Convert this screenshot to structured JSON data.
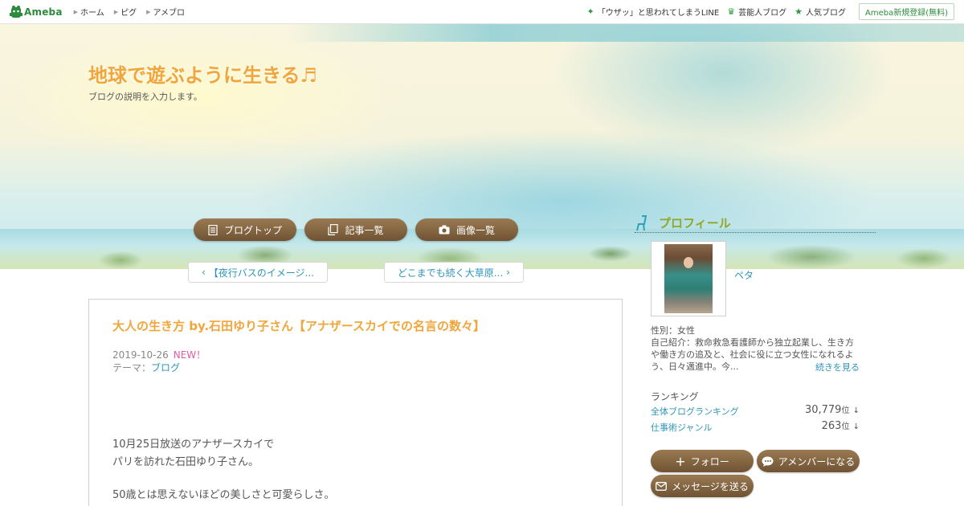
{
  "topbar": {
    "logo_text": "Ameba",
    "nav": [
      {
        "label": "ホーム"
      },
      {
        "label": "ピグ"
      },
      {
        "label": "アメブロ"
      }
    ],
    "right_links": [
      {
        "label": "「ウザッ」と思われてしまうLINE",
        "icon": "sparkle-icon"
      },
      {
        "label": "芸能人ブログ",
        "icon": "crown-icon"
      },
      {
        "label": "人気ブログ",
        "icon": "star-icon"
      }
    ],
    "signup_label": "Ameba新規登録(無料)"
  },
  "blog": {
    "title": "地球で遊ぶように生きる♬",
    "description": "ブログの説明を入力します。"
  },
  "nav_buttons": {
    "top": "ブログトップ",
    "entries": "記事一覧",
    "images": "画像一覧"
  },
  "pager": {
    "prev": "【夜行バスのイメージ...",
    "next": "どこまでも続く大草原..."
  },
  "article": {
    "title": "大人の生き方 by.石田ゆり子さん【アナザースカイでの名言の数々】",
    "date": "2019-10-26",
    "new_badge": "NEW！",
    "theme_label": "テーマ：",
    "theme": "ブログ",
    "body": [
      "10月25日放送のアナザースカイで",
      "パリを訪れた石田ゆり子さん。",
      "50歳とは思えないほどの美しさと可愛らしさ。"
    ]
  },
  "profile": {
    "heading": "プロフィール",
    "peta": "ペタ",
    "gender": "性別：女性",
    "intro": "自己紹介：救命救急看護師から独立起業し、生き方や働き方の追及と、社会に役に立つ女性になれるよう、日々邁進中。今...",
    "more": "続きを見る",
    "ranking_title": "ランキング",
    "rankings": [
      {
        "name": "全体ブログランキング",
        "value": "30,779",
        "unit": "位",
        "trend": "↓"
      },
      {
        "name": "仕事術ジャンル",
        "value": "263",
        "unit": "位",
        "trend": "↓"
      }
    ],
    "follow": "フォロー",
    "amember": "アメンバーになる",
    "message": "メッセージを送る"
  },
  "colors": {
    "title_orange": "#f0a63a",
    "link_blue": "#2f95b8",
    "button_brown": "#7d5f3d",
    "profile_green": "#8fa825",
    "new_pink": "#e35ba4"
  }
}
